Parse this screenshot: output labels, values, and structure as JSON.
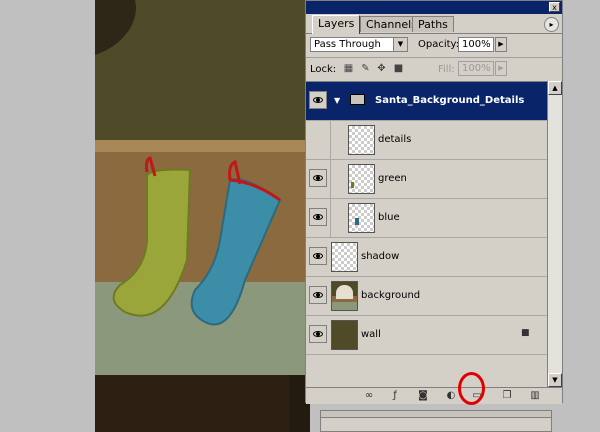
{
  "panel": {
    "tabs": [
      "Layers",
      "Channels",
      "Paths"
    ],
    "close_label": "x",
    "menu_arrow": "▸",
    "blend_mode": "Pass Through",
    "opacity_label": "Opacity:",
    "opacity_value": "100%",
    "lock_label": "Lock:",
    "fill_label": "Fill:",
    "fill_value": "100%"
  },
  "layers": [
    {
      "name": "Santa_Background_Details",
      "type": "group",
      "selected": true
    },
    {
      "name": "details",
      "type": "layer"
    },
    {
      "name": "green",
      "type": "layer"
    },
    {
      "name": "blue",
      "type": "layer"
    },
    {
      "name": "shadow",
      "type": "layer"
    },
    {
      "name": "background",
      "type": "layer"
    },
    {
      "name": "wall",
      "type": "layer",
      "locked": true
    }
  ],
  "icons": {
    "lock_transparency": "checker-lock-icon",
    "lock_paint": "brush-lock-icon",
    "lock_move": "move-lock-icon",
    "lock_all": "padlock-icon",
    "bottom": [
      "link-icon",
      "layer-style-icon",
      "mask-icon",
      "adjustment-icon",
      "new-group-icon",
      "new-layer-icon",
      "trash-icon"
    ]
  },
  "colors": {
    "selection": "#0a246a",
    "highlight_circle": "#e00000"
  }
}
